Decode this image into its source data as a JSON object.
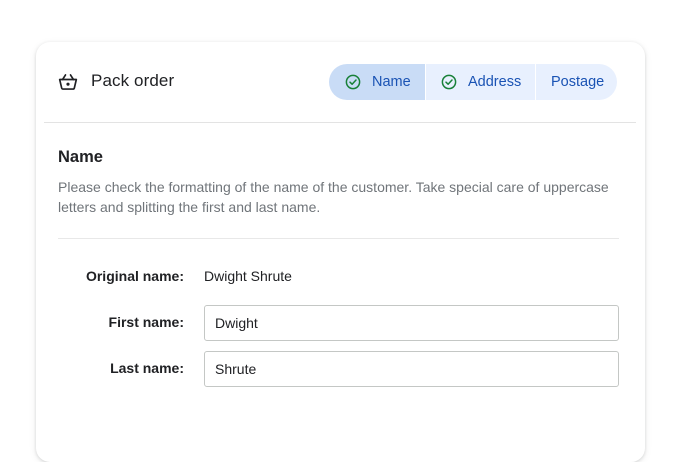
{
  "header": {
    "title": "Pack order",
    "icon": "basket-icon"
  },
  "steps": [
    {
      "label": "Name",
      "completed": true,
      "active": true
    },
    {
      "label": "Address",
      "completed": true,
      "active": false
    },
    {
      "label": "Postage",
      "completed": false,
      "active": false
    }
  ],
  "section": {
    "title": "Name",
    "description": "Please check the formatting of the name of the customer. Take special care of uppercase letters and splitting the first and last name."
  },
  "form": {
    "original_label": "Original name:",
    "original_value": "Dwight Shrute",
    "first_label": "First name:",
    "first_value": "Dwight",
    "last_label": "Last name:",
    "last_value": "Shrute"
  },
  "colors": {
    "accent": "#1a53b4",
    "step_bg": "#e8f0fe",
    "step_active_bg": "#c9dcf6",
    "check": "#188038"
  }
}
